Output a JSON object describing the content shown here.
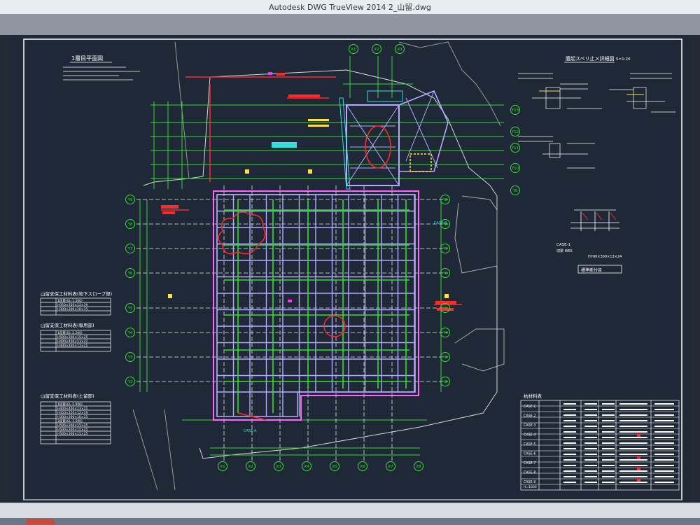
{
  "window": {
    "title": "Autodesk DWG TrueView 2014    2_山留.dwg"
  },
  "drawing": {
    "plan_title": "1層目平面図",
    "detail_title": "腹起スベリ止メ詳細図",
    "detail_scale": "S=1:20",
    "case_label": "CASE-1",
    "case_row1": "切梁 W65",
    "case_row2": "H700×300×13×24",
    "standard_dim_title": "標準断付目",
    "slope_table_title": "山留支保工材料表(地下スロープ部)",
    "slope_table_head": "1段目(GL-1.500)",
    "slope_row1": "H350×350×12×19",
    "slope_row2": "H300×300×10×15",
    "main_table_title": "山留支保工材料表(専用部)",
    "main_table_head": "1段目(GL-2.200)",
    "main_row1": "H500×300×15×25",
    "main_row2": "H400×400×13×21",
    "main_row3": "H400×400×13×21",
    "land_table_title": "山留支保工材料表(土留部)",
    "land_table_head1": "1段目(GL-2.000)",
    "land_row1": "H400×400×13×21",
    "land_row2": "H350×350×12×19",
    "land_row3": "H300×300×10×15",
    "land_table_head2": "2段目(GL-3.500)",
    "land_row4": "H500×300×15×25",
    "land_row5": "H500×300×15×25",
    "land_row6": "H500×300×15×25",
    "material_title": "杭材料表",
    "material_rows": [
      "CASE-1",
      "CASE-2",
      "CASE-3",
      "CASE-4",
      "CASE-5",
      "CASE-6",
      "CASE-7",
      "CASE-8",
      "CASE-9"
    ],
    "material_last_row": "H=1600",
    "grid_y_labels": [
      "Y9",
      "Y8",
      "Y7",
      "Y6",
      "Y5",
      "Y4",
      "Y3",
      "Y2",
      "Y1"
    ],
    "grid_x_labels": [
      "X1",
      "X2",
      "X3",
      "X4",
      "X5",
      "X6",
      "X7",
      "X8"
    ],
    "grid_top_labels": [
      "X1",
      "X2",
      "X3"
    ],
    "grid_right_labels": [
      "Y13",
      "Y12",
      "Y11",
      "Y10",
      "Y9"
    ],
    "case_a_label": "CASE-A",
    "case_b_label": "CASE-B"
  },
  "colors": {
    "cad_background": "#1f2836",
    "border_line": "#ffffff",
    "structure_grid": "#b6a9ff",
    "dimension_lines": "#33dd33",
    "center_lines": "#e8e8e8",
    "annotation_red": "#ff2a2a",
    "annotation_yellow": "#ffe23a",
    "annotation_cyan": "#33e0e0",
    "annotation_magenta": "#ff33ff"
  }
}
